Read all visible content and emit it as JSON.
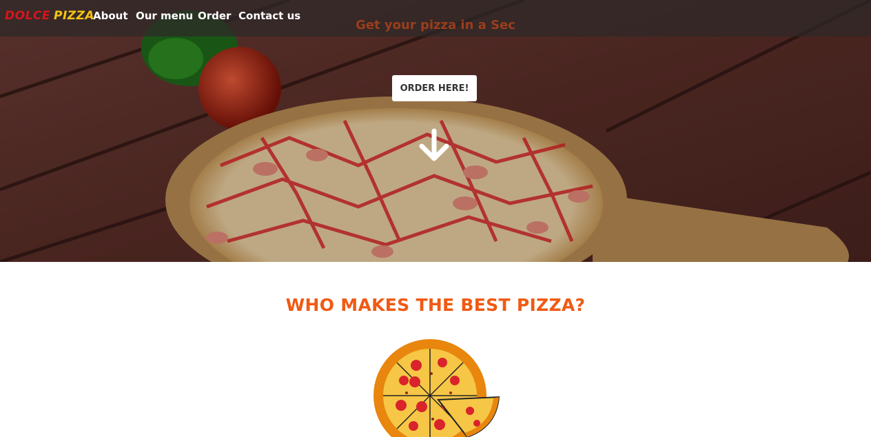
{
  "brand": {
    "word1": "DOLCE",
    "word2": "PIZZA"
  },
  "nav": {
    "about": "About",
    "menu": "Our menu",
    "order": "Order",
    "contact": "Contact us"
  },
  "hero": {
    "tagline": "Get your pizza in a Sec",
    "cta": "ORDER HERE!",
    "scroll_icon": "arrow-down-icon"
  },
  "section": {
    "title": "WHO MAKES THE BEST PIZZA?",
    "icon": "pizza-icon"
  },
  "colors": {
    "accent": "#f05a14",
    "brand_red": "#d8141c",
    "brand_yellow": "#f5c414",
    "nav_bg": "#2d2828"
  }
}
